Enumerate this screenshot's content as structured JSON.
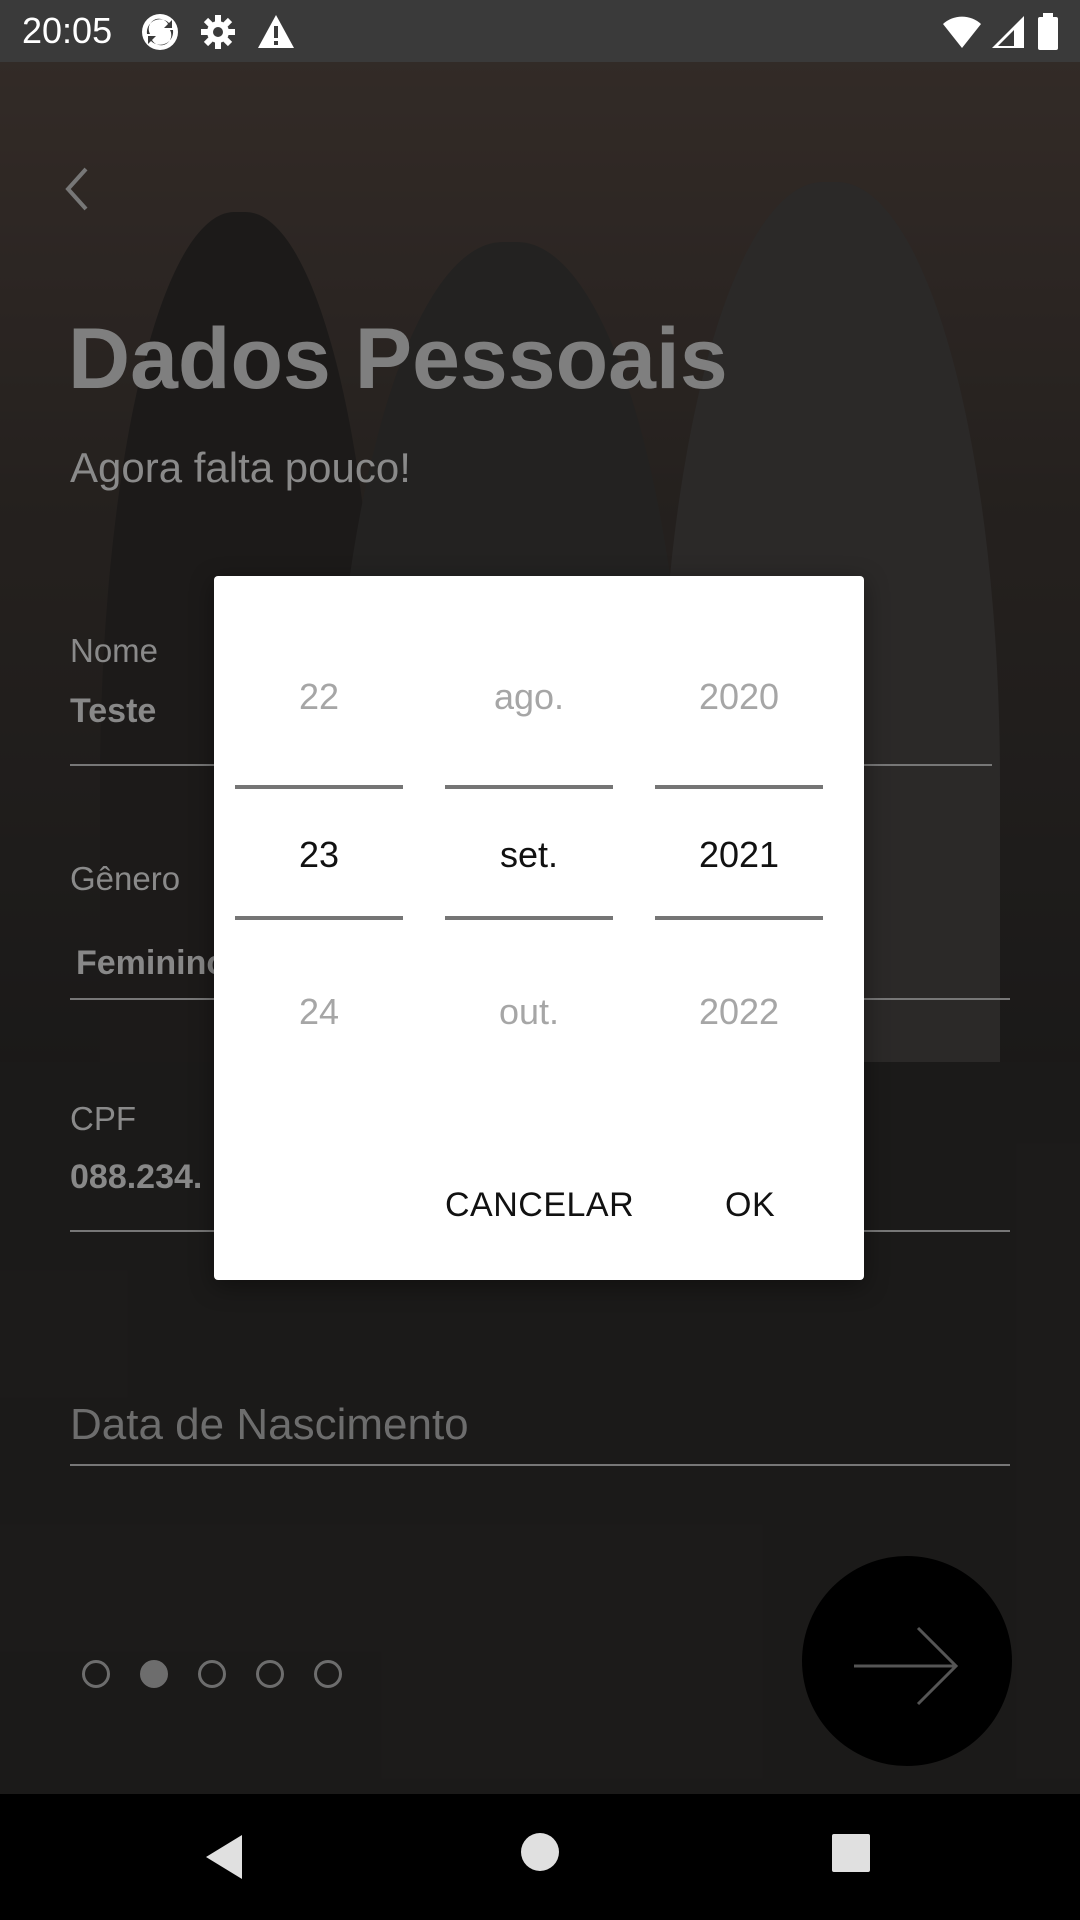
{
  "status_bar": {
    "time": "20:05",
    "left_icons": [
      "sync-app-icon",
      "gear-icon",
      "warning-icon"
    ],
    "right_icons": [
      "wifi-icon",
      "signal-icon",
      "battery-icon"
    ]
  },
  "header": {
    "back_icon": "chevron-left-icon",
    "title": "Dados Pessoais",
    "subtitle": "Agora falta pouco!"
  },
  "form": {
    "name_label": "Nome",
    "name_value": "Teste",
    "gender_label": "Gênero",
    "gender_value": "Feminino",
    "cpf_label": "CPF",
    "cpf_value": "088.234.",
    "birth_date_placeholder": "Data de Nascimento"
  },
  "pager": {
    "total": 5,
    "active_index": 1
  },
  "next_button_icon": "arrow-right-icon",
  "date_picker": {
    "day": {
      "prev": "22",
      "selected": "23",
      "next": "24"
    },
    "month": {
      "prev": "ago.",
      "selected": "set.",
      "next": "out."
    },
    "year": {
      "prev": "2020",
      "selected": "2021",
      "next": "2022"
    },
    "cancel_label": "CANCELAR",
    "ok_label": "OK"
  },
  "nav_bar": {
    "icons": [
      "back-triangle-icon",
      "home-circle-icon",
      "recents-square-icon"
    ]
  },
  "colors": {
    "dialog_bg": "#ffffff",
    "overlay": "#000000",
    "accent_line": "#757575"
  }
}
